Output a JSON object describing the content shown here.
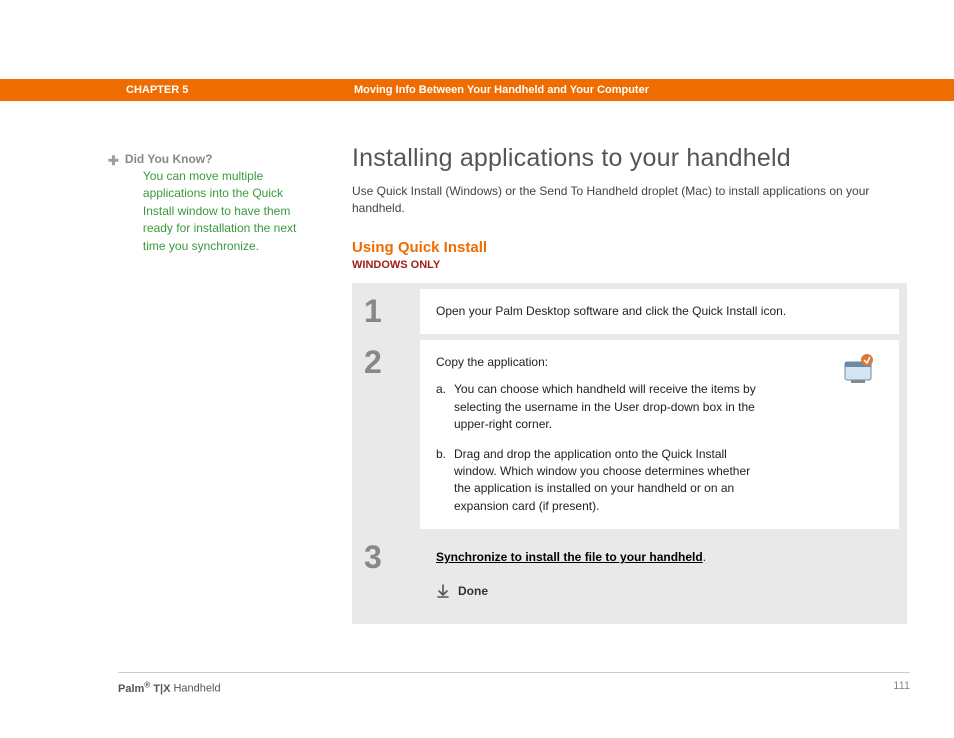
{
  "header": {
    "chapter": "CHAPTER 5",
    "title": "Moving Info Between Your Handheld and Your Computer"
  },
  "sidebar": {
    "tip_label": "Did You Know?",
    "tip_body": "You can move multiple applications into the Quick Install window to have them ready for installation the next time you synchronize."
  },
  "main": {
    "title": "Installing applications to your handheld",
    "intro": "Use Quick Install (Windows) or the Send To Handheld droplet (Mac) to install applications on your handheld.",
    "section_title": "Using Quick Install",
    "platform_note": "WINDOWS ONLY",
    "steps": [
      {
        "num": "1",
        "text": "Open your Palm Desktop software and click the Quick Install icon."
      },
      {
        "num": "2",
        "lead": "Copy the application:",
        "subs": [
          {
            "letter": "a.",
            "text": "You can choose which handheld will receive the items by selecting the username in the User drop-down box in the upper-right corner."
          },
          {
            "letter": "b.",
            "text": "Drag and drop the application onto the Quick Install window. Which window you choose determines whether the application is installed on your handheld or on an expansion card (if present)."
          }
        ]
      },
      {
        "num": "3",
        "link_text": "Synchronize to install the file to your handheld",
        "done": "Done"
      }
    ]
  },
  "footer": {
    "brand": "Palm",
    "model": "T|X",
    "product": "Handheld",
    "page": "111"
  }
}
